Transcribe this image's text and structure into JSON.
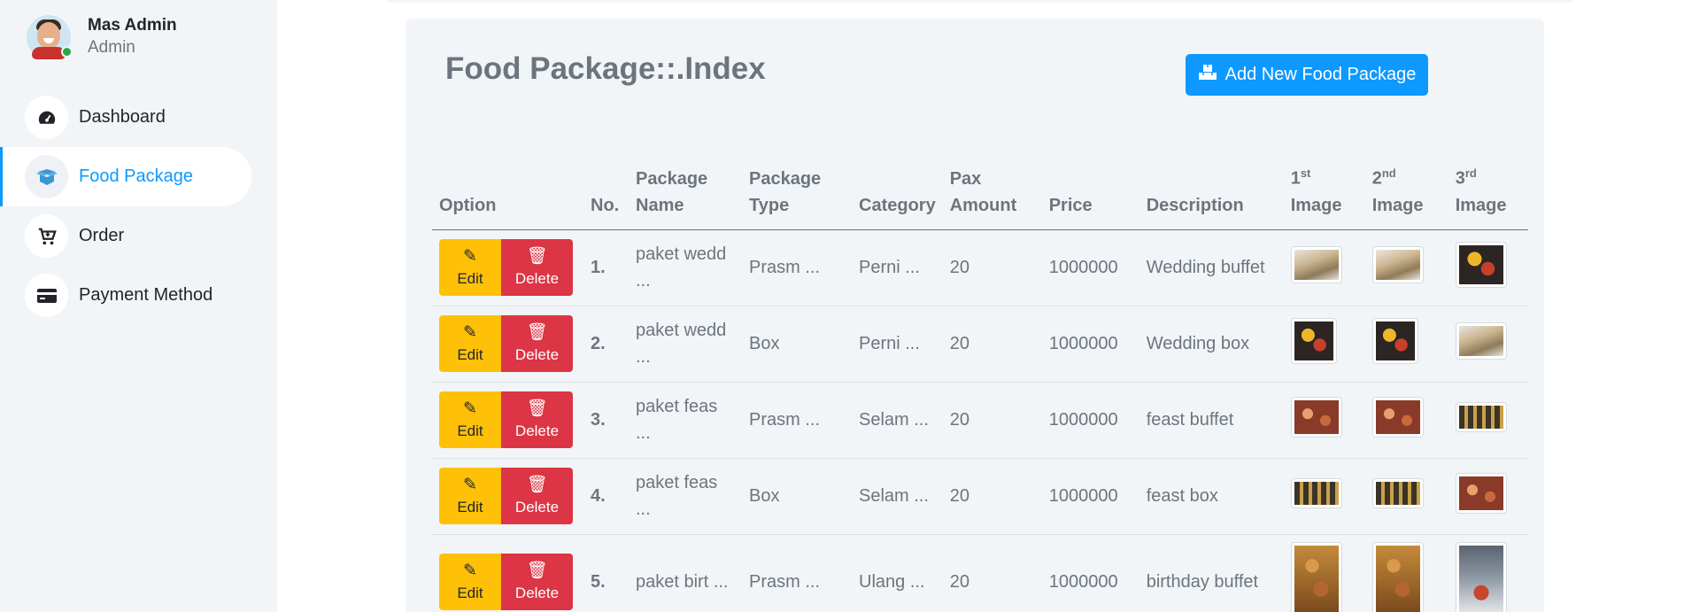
{
  "user": {
    "name": "Mas Admin",
    "role": "Admin"
  },
  "sidebar": {
    "items": [
      {
        "label": "Dashboard",
        "icon": "dashboard-icon"
      },
      {
        "label": "Food Package",
        "icon": "box-icon",
        "active": true
      },
      {
        "label": "Order",
        "icon": "cart-icon"
      },
      {
        "label": "Payment Method",
        "icon": "credit-card-icon"
      }
    ]
  },
  "page": {
    "title": "Food Package::.Index",
    "add_button": "Add New Food Package"
  },
  "table": {
    "headers": {
      "option": "Option",
      "no": "No.",
      "package_name_1": "Package",
      "package_name_2": "Name",
      "package_type_1": "Package",
      "package_type_2": "Type",
      "category": "Category",
      "pax_1": "Pax",
      "pax_2": "Amount",
      "price": "Price",
      "description": "Description",
      "img1_num": "1",
      "img1_sup": "st",
      "img2_num": "2",
      "img2_sup": "nd",
      "img3_num": "3",
      "img3_sup": "rd",
      "image": "Image"
    },
    "edit_label": "Edit",
    "delete_label": "Delete",
    "rows": [
      {
        "no": "1.",
        "name": "paket wedd ...",
        "type": "Prasm ...",
        "category": "Perni ...",
        "pax": "20",
        "price": "1000000",
        "description": "Wedding buffet"
      },
      {
        "no": "2.",
        "name": "paket wedd ...",
        "type": "Box",
        "category": "Perni ...",
        "pax": "20",
        "price": "1000000",
        "description": "Wedding box"
      },
      {
        "no": "3.",
        "name": "paket feas ...",
        "type": "Prasm ...",
        "category": "Selam ...",
        "pax": "20",
        "price": "1000000",
        "description": "feast buffet"
      },
      {
        "no": "4.",
        "name": "paket feas ...",
        "type": "Box",
        "category": "Selam ...",
        "pax": "20",
        "price": "1000000",
        "description": "feast box"
      },
      {
        "no": "5.",
        "name": "paket birt ...",
        "type": "Prasm ...",
        "category": "Ulang ...",
        "pax": "20",
        "price": "1000000",
        "description": "birthday buffet"
      }
    ]
  },
  "colors": {
    "accent": "#0d99ff",
    "edit": "#ffc107",
    "delete": "#dc3545",
    "panel": "#f2f5f8"
  }
}
